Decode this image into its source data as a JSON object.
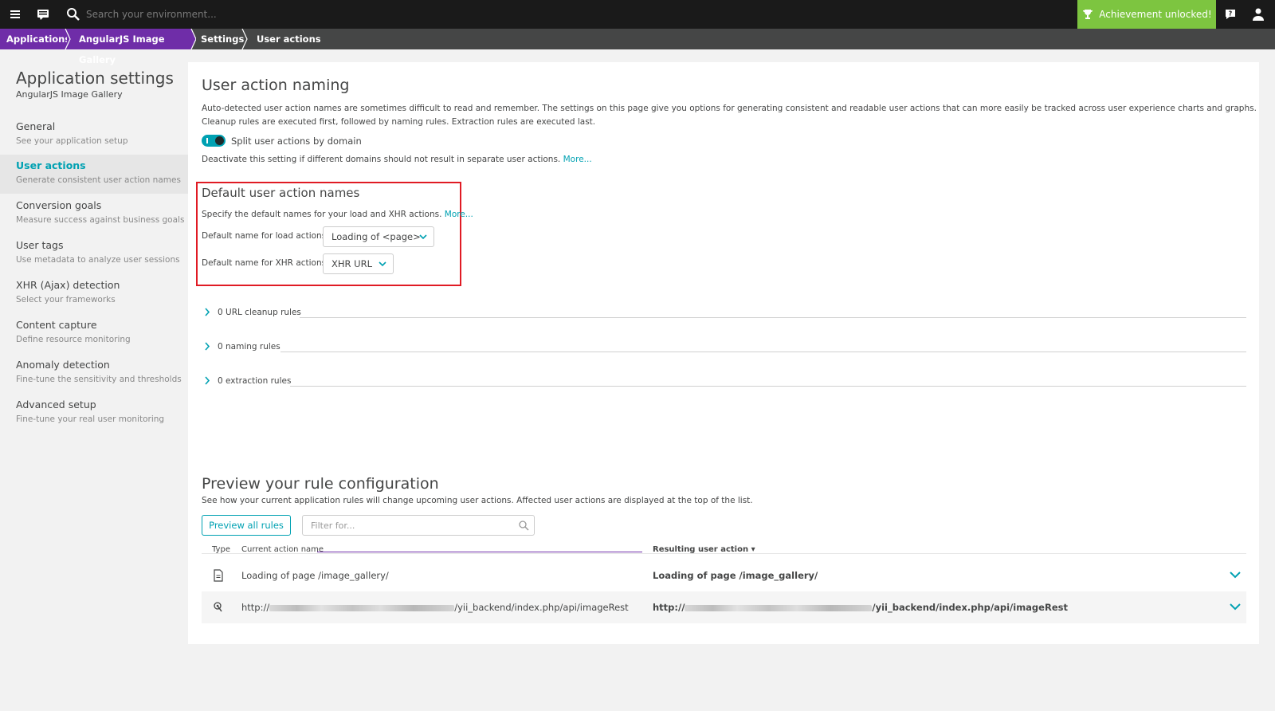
{
  "topbar": {
    "search_placeholder": "Search your environment...",
    "achievement_label": "Achievement unlocked!"
  },
  "breadcrumb": {
    "items": [
      "Applications",
      "AngularJS Image Gallery",
      "Settings",
      "User actions"
    ]
  },
  "sidebar": {
    "title": "Application settings",
    "subtitle": "AngularJS Image Gallery",
    "items": [
      {
        "label": "General",
        "desc": "See your application setup"
      },
      {
        "label": "User actions",
        "desc": "Generate consistent user action names"
      },
      {
        "label": "Conversion goals",
        "desc": "Measure success against business goals"
      },
      {
        "label": "User tags",
        "desc": "Use metadata to analyze user sessions"
      },
      {
        "label": "XHR (Ajax) detection",
        "desc": "Select your frameworks"
      },
      {
        "label": "Content capture",
        "desc": "Define resource monitoring"
      },
      {
        "label": "Anomaly detection",
        "desc": "Fine-tune the sensitivity and thresholds"
      },
      {
        "label": "Advanced setup",
        "desc": "Fine-tune your real user monitoring"
      }
    ],
    "active_index": 1
  },
  "main": {
    "title": "User action naming",
    "intro_line1": "Auto-detected user action names are sometimes difficult to read and remember. The settings on this page give you options for generating consistent and readable user actions that can more easily be tracked across user experience charts and graphs.",
    "intro_line2": "Cleanup rules are executed first, followed by naming rules. Extraction rules are executed last.",
    "split_toggle_label": "Split user actions by domain",
    "split_toggle_on": true,
    "split_desc": "Deactivate this setting if different domains should not result in separate user actions.",
    "more_link": "More...",
    "defaults": {
      "title": "Default user action names",
      "desc": "Specify the default names for your load and XHR actions.",
      "more_link": "More...",
      "load_label": "Default name for load actions:",
      "load_value": "Loading of <page>",
      "xhr_label": "Default name for XHR actions:",
      "xhr_value": "XHR URL"
    },
    "rules": [
      {
        "label": "0 URL cleanup rules"
      },
      {
        "label": "0 naming rules"
      },
      {
        "label": "0 extraction rules"
      }
    ]
  },
  "preview": {
    "title": "Preview your rule configuration",
    "desc": "See how your current application rules will change upcoming user actions. Affected user actions are displayed at the top of the list.",
    "button_label": "Preview all rules",
    "filter_placeholder": "Filter for...",
    "columns": {
      "type": "Type",
      "current": "Current action name",
      "resulting": "Resulting user action ▾"
    },
    "rows": [
      {
        "type_icon": "document-icon",
        "current": "Loading of page /image_gallery/",
        "resulting": "Loading of page /image_gallery/"
      },
      {
        "type_icon": "xhr-icon",
        "current_prefix": "http://",
        "current_suffix": "/yii_backend/index.php/api/imageRest",
        "resulting_prefix": "http://",
        "resulting_suffix": "/yii_backend/index.php/api/imageRest"
      }
    ]
  },
  "colors": {
    "topbar": "#1a1a1a",
    "breadcrumb_accent": "#6f2da8",
    "breadcrumb_bg": "#454646",
    "achievement": "#7dc540",
    "accent": "#00a1b2",
    "highlight_box": "#e01b24"
  }
}
